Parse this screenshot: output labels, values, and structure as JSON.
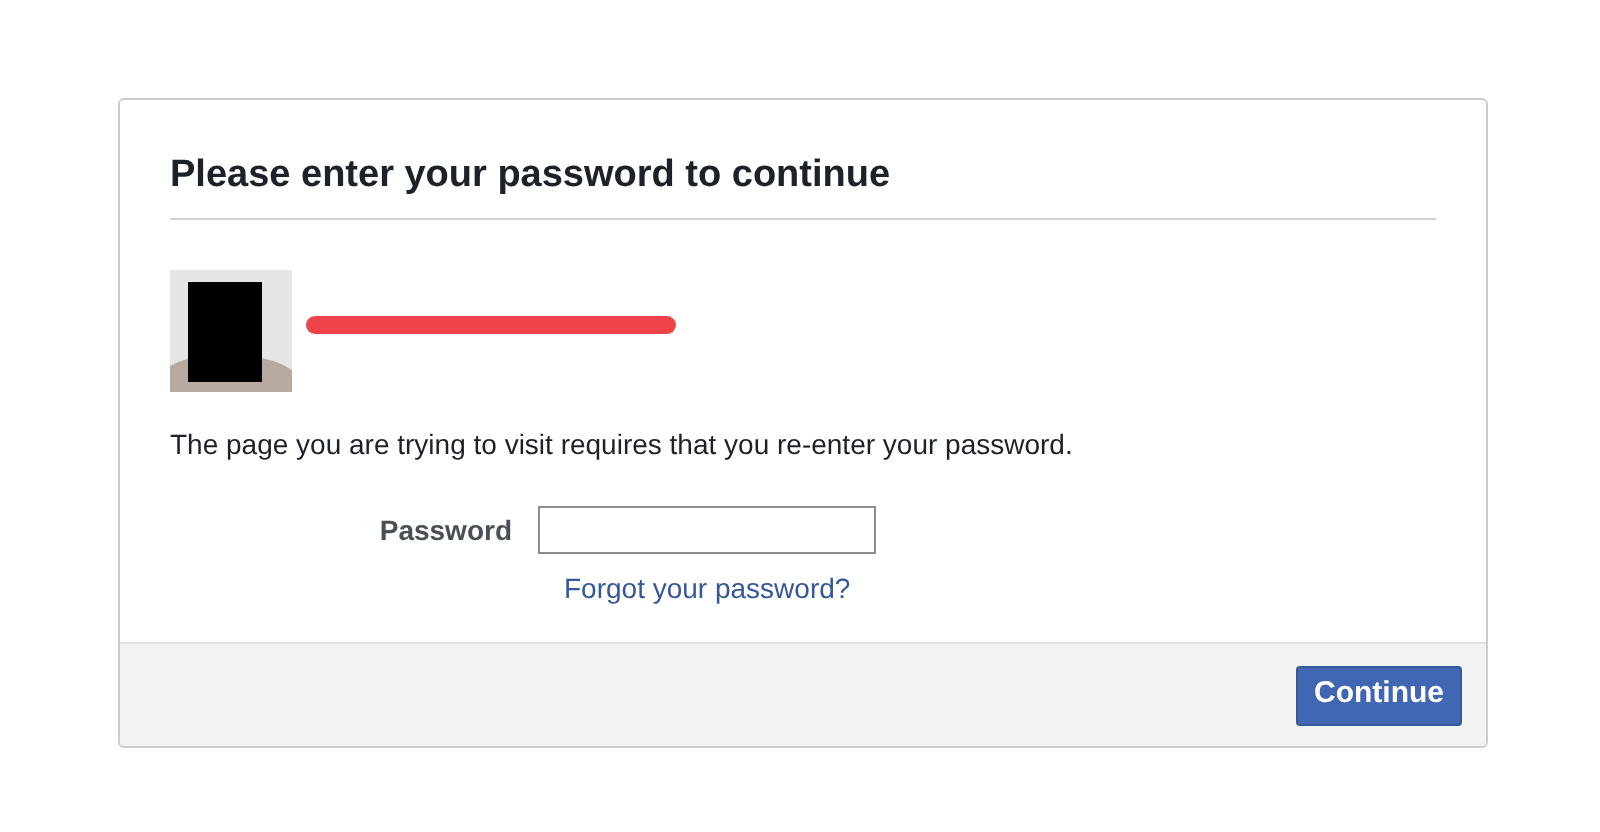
{
  "dialog": {
    "title": "Please enter your password to continue",
    "message": "The page you are trying to visit requires that you re-enter your password.",
    "password_field": {
      "label": "Password"
    },
    "forgot_link": "Forgot your password?",
    "buttons": [
      "Continue"
    ]
  }
}
